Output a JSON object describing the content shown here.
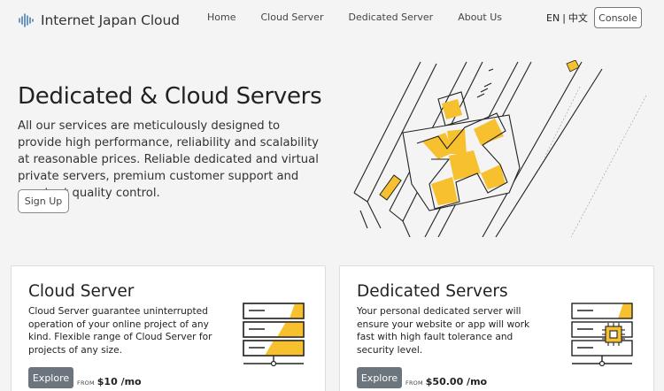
{
  "header": {
    "brand": "Internet Japan Cloud",
    "nav": [
      "Home",
      "Cloud Server",
      "Dedicated Server",
      "About Us"
    ],
    "lang_en": "EN",
    "lang_sep": "|",
    "lang_zh": "中文",
    "console_label": "Console"
  },
  "hero": {
    "title": "Dedicated & Cloud Servers",
    "description": "All our services are meticulously designed to provide high performance, reliability and scalability at reasonable prices. Reliable dedicated and virtual private servers, premium customer support and constant quality control.",
    "signup_label": "Sign Up"
  },
  "cards": [
    {
      "title": "Cloud Server",
      "description": "Cloud Server guarantee uninterrupted operation of your online project of any kind. Flexible range of Cloud Server for projects of any size.",
      "explore_label": "Explore",
      "from_label": "FROM",
      "price": "$10 /mo",
      "icon": "server-rack-icon"
    },
    {
      "title": "Dedicated Servers",
      "description": "Your personal dedicated server will ensure your website or app will work fast with high fault tolerance and security level.",
      "explore_label": "Explore",
      "from_label": "FROM",
      "price": "$50.00 /mo",
      "icon": "server-chip-icon"
    }
  ],
  "colors": {
    "accent": "#f6c02e",
    "button_gray": "#6c757d",
    "background": "#f4f4f5"
  }
}
